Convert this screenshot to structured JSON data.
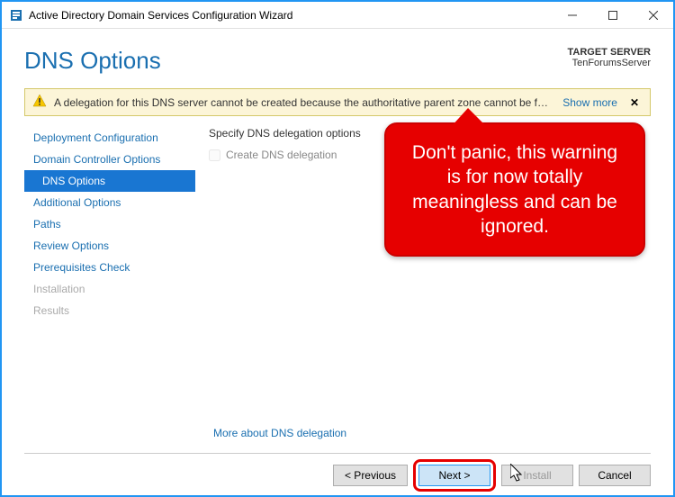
{
  "window": {
    "title": "Active Directory Domain Services Configuration Wizard"
  },
  "header": {
    "title": "DNS Options",
    "target_label": "TARGET SERVER",
    "target_name": "TenForumsServer"
  },
  "warning": {
    "text": "A delegation for this DNS server cannot be created because the authoritative parent zone cannot be found...",
    "show_more": "Show more"
  },
  "sidebar": {
    "items": [
      {
        "label": "Deployment Configuration",
        "state": "normal"
      },
      {
        "label": "Domain Controller Options",
        "state": "normal"
      },
      {
        "label": "DNS Options",
        "state": "active"
      },
      {
        "label": "Additional Options",
        "state": "normal"
      },
      {
        "label": "Paths",
        "state": "normal"
      },
      {
        "label": "Review Options",
        "state": "normal"
      },
      {
        "label": "Prerequisites Check",
        "state": "normal"
      },
      {
        "label": "Installation",
        "state": "disabled"
      },
      {
        "label": "Results",
        "state": "disabled"
      }
    ]
  },
  "main": {
    "section_label": "Specify DNS delegation options",
    "checkbox_label": "Create DNS delegation",
    "more_link": "More about DNS delegation"
  },
  "callout": {
    "text": "Don't panic, this warning is for now totally meaningless and can be ignored."
  },
  "footer": {
    "previous": "< Previous",
    "next": "Next >",
    "install": "Install",
    "cancel": "Cancel"
  }
}
